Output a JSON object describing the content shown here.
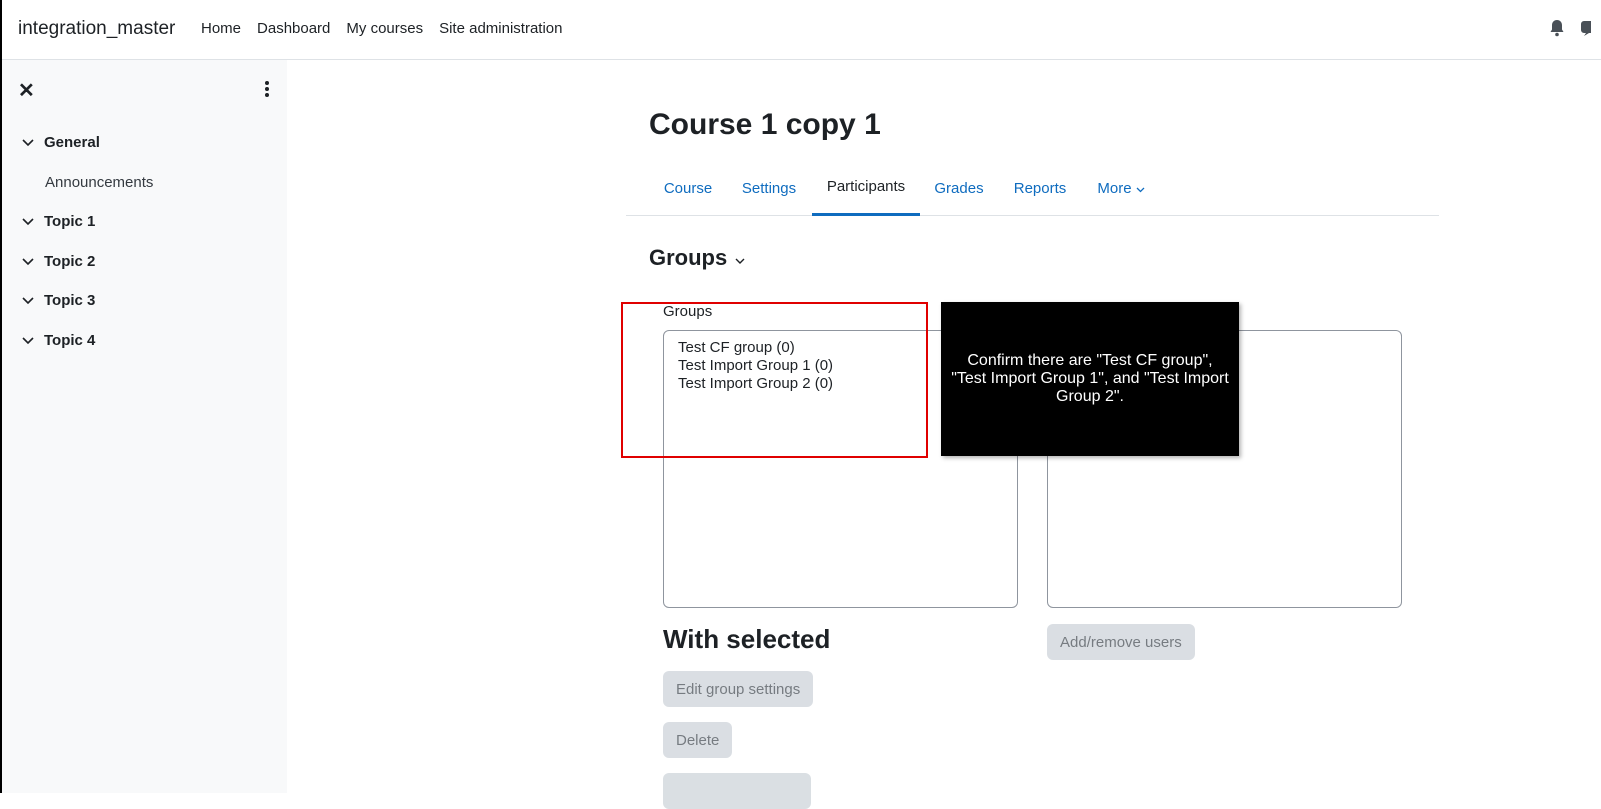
{
  "navbar": {
    "brand": "integration_master",
    "links": [
      "Home",
      "Dashboard",
      "My courses",
      "Site administration"
    ],
    "icons": [
      "bell-icon",
      "chat-icon"
    ]
  },
  "sidebar": {
    "close_icon": "close-icon",
    "menu_icon": "kebab-menu-icon",
    "sections": [
      {
        "label": "General"
      },
      {
        "label": "Topic 1"
      },
      {
        "label": "Topic 2"
      },
      {
        "label": "Topic 3"
      },
      {
        "label": "Topic 4"
      }
    ],
    "general_items": [
      "Announcements"
    ]
  },
  "main": {
    "course_title": "Course 1 copy 1",
    "tabs": [
      {
        "label": "Course"
      },
      {
        "label": "Settings"
      },
      {
        "label": "Participants",
        "active": true
      },
      {
        "label": "Grades"
      },
      {
        "label": "Reports"
      },
      {
        "label": "More"
      }
    ],
    "groups_heading": "Groups",
    "groups_label": "Groups",
    "groups": [
      "Test CF group (0)",
      "Test Import Group 1 (0)",
      "Test Import Group 2 (0)"
    ],
    "with_selected": "With selected",
    "buttons": {
      "edit_group_settings": "Edit group settings",
      "delete": "Delete",
      "add_remove_users": "Add/remove users"
    }
  },
  "overlay": {
    "tooltip_text": "Confirm there are \"Test CF group\", \"Test Import Group 1\", and \"Test Import Group 2\".",
    "highlight_color": "#e00000"
  },
  "colors": {
    "link": "#0f6cbf",
    "sidebar_bg": "#f8f9fa"
  }
}
